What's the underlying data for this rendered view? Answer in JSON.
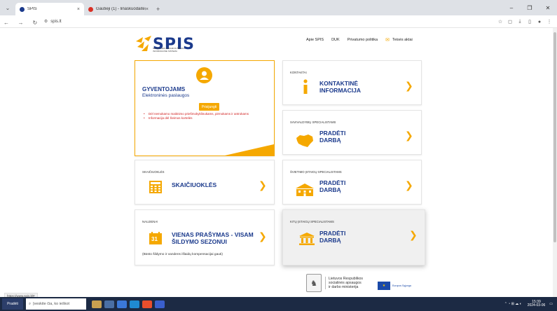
{
  "browser": {
    "tab_active": "SPIS",
    "tab_other": "Gautieji (1) - linaskuodaite@...",
    "new_tab": "+",
    "url": "spis.lt",
    "status_url": "https://www.spis.lt/#"
  },
  "logo": {
    "name": "SPIS",
    "subtitle": "SOCIALINĖS PARAMOS ŠEIMAI INFORMACINĖ SISTEMA"
  },
  "topnav": {
    "apie": "Apie SPIS",
    "duk": "DUK",
    "privatumas": "Privatumo politika",
    "teises": "Teisės aktai"
  },
  "cards": {
    "resident": {
      "title": "GYVENTOJAMS",
      "subtitle": "Elektroninės paslaugos",
      "login": "Prisijungti",
      "items": [
        "Dėl nemokamo maitinimo priešmokyklinukams, pirmokams ir antrokams",
        "Informacija dėl Šeimos kortelės"
      ]
    },
    "kontaktai": {
      "category": "KONTAKTAI",
      "title1": "KONTAKTINĖ",
      "title2": "INFORMACIJA"
    },
    "savivaldybiu": {
      "category": "SAVIVALDYBIŲ SPECIALISTAMS",
      "title1": "PRADĖTI",
      "title2": "DARBĄ"
    },
    "skaiciuokles": {
      "category": "SKAIČIUOKLĖS",
      "title1": "SKAIČIUOKLĖS"
    },
    "svietimo": {
      "category": "ŠVIETIMO ĮSTAIGŲ SPECIALISTAMS",
      "title1": "PRADĖTI",
      "title2": "DARBĄ"
    },
    "naujiena": {
      "category": "NAUJIENA!",
      "title1": "VIENAS PRAŠYMAS - VISAM",
      "title2": "ŠILDYMO SEZONUI",
      "footnote": "(Būsto šildymo ir vandens išlaidų kompensacijai gauti)",
      "date": "31"
    },
    "kitu": {
      "category": "KITŲ ĮSTAIGŲ SPECIALISTAMS",
      "title1": "PRADĖTI",
      "title2": "DARBĄ"
    }
  },
  "footer": {
    "ministry": [
      "Lietuvos Respublikos",
      "socialinės apsaugos",
      "ir darbo ministerija"
    ],
    "eu": "Europos Sąjunga"
  },
  "taskbar": {
    "start": "Pradėti",
    "search": "Įveskite čia, ko ieškot",
    "time": "15:39",
    "date": "2024-03-06"
  },
  "colors": {
    "accent": "#f5a800",
    "brand": "#1b3a8c"
  }
}
